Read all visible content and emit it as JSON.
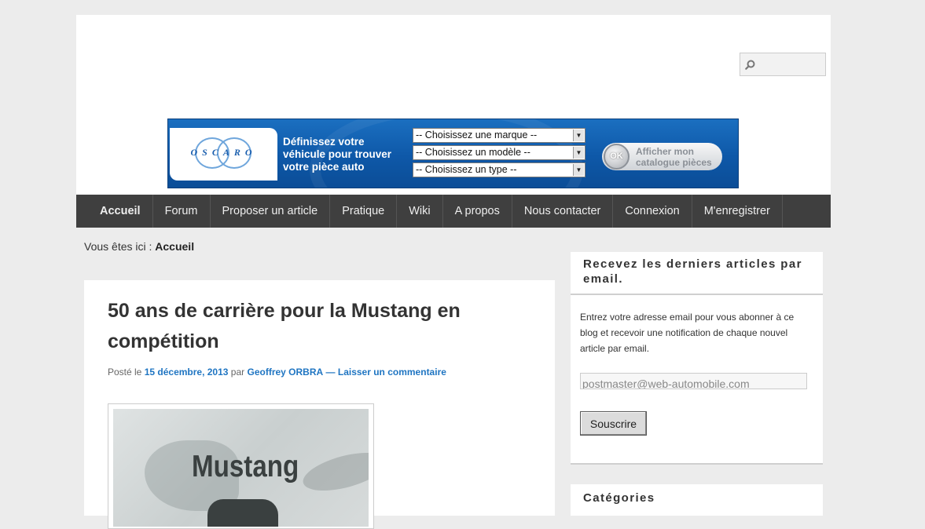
{
  "search": {
    "placeholder": ""
  },
  "banner": {
    "logo": "OSCARO",
    "line1": "Définissez votre",
    "line2": "véhicule pour trouver",
    "line3": "votre pièce auto",
    "select_brand": "-- Choisissez une marque --",
    "select_model": "-- Choisissez un modèle --",
    "select_type": "-- Choisissez un type --",
    "ok": "OK",
    "button_line1": "Afficher mon",
    "button_line2": "catalogue pièces"
  },
  "nav": {
    "items": [
      "Accueil",
      "Forum",
      "Proposer un article",
      "Pratique",
      "Wiki",
      "A propos",
      "Nous contacter",
      "Connexion",
      "M'enregistrer"
    ]
  },
  "breadcrumb": {
    "prefix": "Vous êtes ici :",
    "current": "Accueil"
  },
  "article": {
    "title": "50 ans de carrière pour la Mustang en compétition",
    "posted": "Posté le",
    "date": "15 décembre, 2013",
    "by": "par",
    "author": "Geoffrey ORBRA",
    "dash": "—",
    "comment_link": "Laisser un commentaire",
    "image_word": "Mustang"
  },
  "sidebar": {
    "subscribe_title": "Recevez les derniers articles par email.",
    "subscribe_desc": "Entrez votre adresse email pour vous abonner à ce blog et recevoir une notification de chaque nouvel article par email.",
    "email_value": "postmaster@web-automobile.com",
    "subscribe_button": "Souscrire",
    "categories_title": "Catégories"
  },
  "colors": {
    "nav_bg": "#3f3f3f",
    "banner_blue": "#0e58a8",
    "link": "#1f75c2",
    "page_bg": "#ececec"
  }
}
